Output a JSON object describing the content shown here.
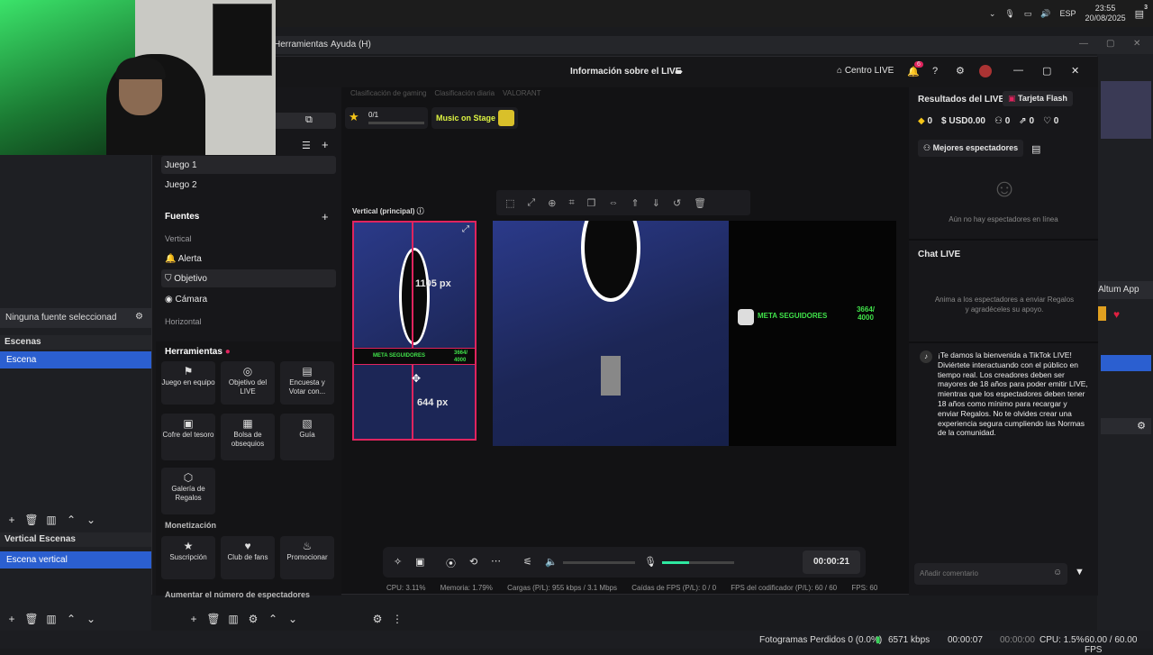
{
  "tray": {
    "lang": "ESP",
    "time": "23:55",
    "date": "20/08/2025",
    "notif_count": "3"
  },
  "obs_menu": {
    "items": [
      "Herramientas",
      "Ayuda (H)"
    ]
  },
  "obs": {
    "no_source": "Ninguna fuente seleccionad",
    "scenes_title": "Escenas",
    "scene_item": "Escena",
    "vertical_scenes_title": "Vertical Escenas",
    "vertical_scene_item": "Escena vertical",
    "altum": "Altum App"
  },
  "status": {
    "dropped": "Fotogramas Perdidos 0 (0.0%)",
    "kbps": "6571 kbps",
    "rec_time": "00:00:07",
    "stream_time": "00:00:00",
    "cpu": "CPU: 1.5%",
    "fps": "60.00 / 60.00 FPS"
  },
  "ttk": {
    "title": "Información sobre el LIVE",
    "centro": "Centro LIVE",
    "notif": "6",
    "scenes": [
      "Juego 1",
      "Juego 2"
    ],
    "fuentes": "Fuentes",
    "vertical": "Vertical",
    "sources": [
      "Alerta",
      "Objetivo",
      "Cámara"
    ],
    "horizontal": "Horizontal",
    "herramientas": "Herramientas",
    "tools": [
      {
        "label": "Juego en equipo",
        "icon": "team-icon"
      },
      {
        "label": "Objetivo del LIVE",
        "icon": "goal-icon"
      },
      {
        "label": "Encuesta y Votar con...",
        "icon": "poll-icon"
      },
      {
        "label": "Cofre del tesoro",
        "icon": "chest-icon"
      },
      {
        "label": "Bolsa de obsequios",
        "icon": "gift-bag-icon"
      },
      {
        "label": "Guía",
        "icon": "guide-icon"
      },
      {
        "label": "Galería de Regalos",
        "icon": "gallery-icon"
      }
    ],
    "monetizacion": "Monetización",
    "money_tools": [
      {
        "label": "Suscripción",
        "icon": "star-icon"
      },
      {
        "label": "Club de fans",
        "icon": "heart-icon"
      },
      {
        "label": "Promocionar",
        "icon": "flame-icon"
      }
    ],
    "aumentar": "Aumentar el número de espectadores",
    "top_tags": [
      "Clasificación de gaming",
      "Clasificación diaria",
      "VALORANT"
    ],
    "stars": "0/1",
    "music": "Music on Stage",
    "vertical_label": "Vertical (principal)",
    "px_top": "1105 px",
    "px_bottom": "644 px",
    "meta": "META SEGUIDORES",
    "meta_count": "3664/ 4000",
    "timer": "00:00:21",
    "stats": [
      "CPU: 3.11%",
      "Memoria: 1.79%",
      "Cargas (P/L): 955 kbps / 3.1 Mbps",
      "Caídas de FPS (P/L): 0 / 0",
      "FPS del codificador (P/L): 60 / 60",
      "FPS: 60"
    ],
    "results_title": "Resultados del LIVE",
    "flash": "Tarjeta Flash",
    "metrics": [
      "0",
      "USD0.00",
      "0",
      "0",
      "0"
    ],
    "best_viewers": "Mejores espectadores",
    "no_viewers": "Aún no hay espectadores en línea",
    "chat_title": "Chat LIVE",
    "chat_hint": "Anima a los espectadores a enviar Regalos y agradéceles su apoyo.",
    "welcome": "¡Te damos la bienvenida a TikTok LIVE! Diviértete interactuando con el público en tiempo real. Los creadores deben ser mayores de 18 años para poder emitir LIVE, mientras que los espectadores deben tener 18 años como mínimo para recargar y enviar Regalos. No te olvides crear una experiencia segura cumpliendo las Normas de la comunidad.",
    "comment_placeholder": "Añadir comentario"
  }
}
